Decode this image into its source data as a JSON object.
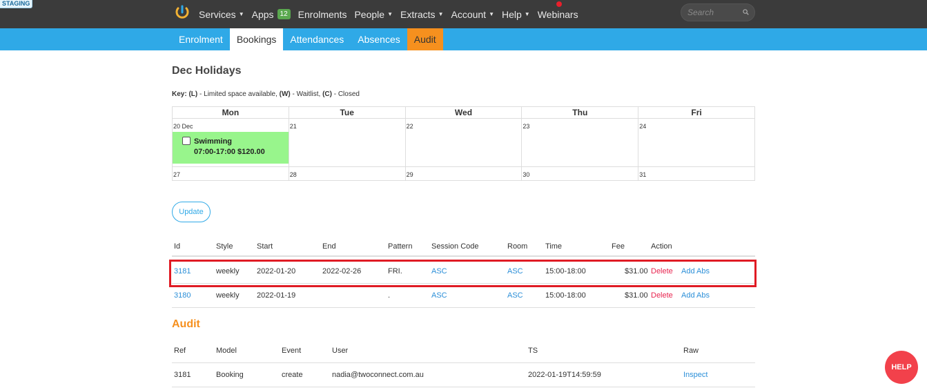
{
  "env_badge": "STAGING",
  "nav": {
    "items": [
      {
        "label": "Services",
        "caret": true
      },
      {
        "label": "Apps",
        "badge": "12"
      },
      {
        "label": "Enrolments"
      },
      {
        "label": "People",
        "caret": true
      },
      {
        "label": "Extracts",
        "caret": true
      },
      {
        "label": "Account",
        "caret": true
      },
      {
        "label": "Help",
        "caret": true
      },
      {
        "label": "Webinars"
      }
    ],
    "search_placeholder": "Search"
  },
  "tabs": [
    "Enrolment",
    "Bookings",
    "Attendances",
    "Absences",
    "Audit"
  ],
  "active_tab": "Bookings",
  "page_title": "Dec Holidays",
  "key": {
    "label": "Key:",
    "l_code": "(L)",
    "l_text": " - Limited space available, ",
    "w_code": "(W)",
    "w_text": " - Waitlist, ",
    "c_code": "(C)",
    "c_text": " - Closed"
  },
  "calendar": {
    "days": [
      "Mon",
      "Tue",
      "Wed",
      "Thu",
      "Fri"
    ],
    "week1": [
      "20 Dec",
      "21",
      "22",
      "23",
      "24"
    ],
    "week2": [
      "27",
      "28",
      "29",
      "30",
      "31"
    ],
    "session": {
      "name": "Swimming",
      "detail": "07:00-17:00 $120.00",
      "color": "#98f58c"
    }
  },
  "update_label": "Update",
  "bookings": {
    "headers": [
      "Id",
      "Style",
      "Start",
      "End",
      "Pattern",
      "Session Code",
      "Room",
      "Time",
      "Fee",
      "Action"
    ],
    "rows": [
      {
        "id": "3181",
        "style": "weekly",
        "start": "2022-01-20",
        "end": "2022-02-26",
        "pattern": "FRI.",
        "session_code": "ASC",
        "room": "ASC",
        "time": "15:00-18:00",
        "fee": "$31.00",
        "delete": "Delete",
        "add_abs": "Add Abs"
      },
      {
        "id": "3180",
        "style": "weekly",
        "start": "2022-01-19",
        "end": "",
        "pattern": ".",
        "session_code": "ASC",
        "room": "ASC",
        "time": "15:00-18:00",
        "fee": "$31.00",
        "delete": "Delete",
        "add_abs": "Add Abs"
      }
    ]
  },
  "audit": {
    "title": "Audit",
    "headers": [
      "Ref",
      "Model",
      "Event",
      "User",
      "TS",
      "Raw"
    ],
    "rows": [
      {
        "ref": "3181",
        "model": "Booking",
        "event": "create",
        "user": "nadia@twoconnect.com.au",
        "ts": "2022-01-19T14:59:59",
        "raw": "Inspect"
      }
    ]
  },
  "help_label": "HELP",
  "colors": {
    "topbar": "#3b3b3b",
    "tabbar": "#2fa9e7",
    "audit_tab": "#f6901e",
    "highlight": "#e01b24",
    "help": "#f2414b",
    "link": "#2b8fd8",
    "delete": "#e8244f"
  }
}
